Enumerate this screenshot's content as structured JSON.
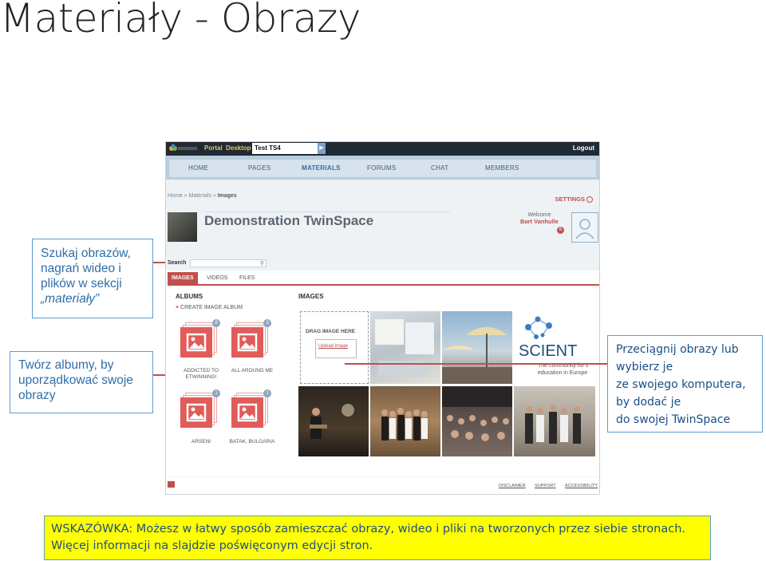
{
  "slide": {
    "title": "Materiały - Obrazy"
  },
  "callouts": {
    "search": {
      "lines": [
        "Szukaj obrazów,",
        "nagrań wideo i",
        "plików w sekcji",
        "„materiały”"
      ]
    },
    "albums": {
      "lines": [
        "Twórz albumy, by",
        "uporządkować swoje",
        "obrazy"
      ]
    },
    "drag": {
      "lines": [
        "Przeciągnij obrazy lub",
        "wybierz je",
        "ze swojego komputera,",
        "by dodać je",
        "do swojej TwinSpace"
      ]
    }
  },
  "tip": {
    "line1": "WSKAZÓWKA: Możesz w łatwy sposób zamieszczać obrazy, wideo i pliki na tworzonych przez siebie stronach.",
    "line2": "Więcej informacji na slajdzie poświęconym edycji stron."
  },
  "app": {
    "topbar": {
      "portal": "Portal",
      "desktop": "Desktop",
      "workspace": "Test TS4",
      "logout": "Logout"
    },
    "nav": [
      "HOME",
      "PAGES",
      "MATERIALS",
      "FORUMS",
      "CHAT",
      "MEMBERS"
    ],
    "nav_active": "MATERIALS",
    "breadcrumb": {
      "home": "Home",
      "materials": "Materials",
      "images": "Images"
    },
    "settings_label": "SETTINGS",
    "twinspace_title": "Demonstration TwinSpace",
    "welcome": {
      "label": "Welcome",
      "user": "Bart Vanhulle",
      "notifications": "6"
    },
    "search": {
      "label": "Search",
      "placeholder": ""
    },
    "tabs": [
      "IMAGES",
      "VIDEOS",
      "FILES"
    ],
    "albums_heading": "ALBUMS",
    "create_album": "CREATE IMAGE ALBUM",
    "images_heading": "IMAGES",
    "albums": [
      {
        "name": "ADDICTED TO ETWINNING!",
        "count": "8"
      },
      {
        "name": "ALL AROUND ME",
        "count": "3"
      },
      {
        "name": "ARSENI",
        "count": "1"
      },
      {
        "name": "BATAK, BULGARIA",
        "count": "1"
      }
    ],
    "dropzone": {
      "title": "DRAG IMAGE HERE",
      "link": "Upload image"
    },
    "footer_links": [
      "DISCLAIMER",
      "SUPPORT",
      "ACCESSIBILITY"
    ]
  },
  "colors": {
    "accent": "#c0504d",
    "callout_border": "#5b9bd5",
    "tip_bg": "#ffff00"
  }
}
